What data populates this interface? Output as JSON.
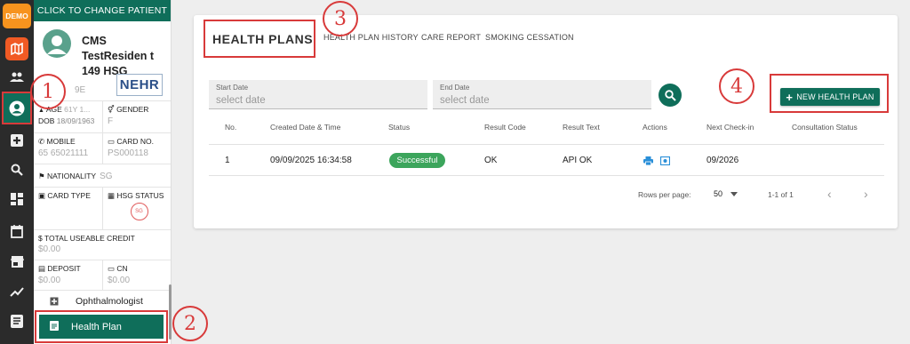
{
  "rail": {
    "demo_label": "DEMO",
    "icons": [
      "map-icon",
      "users-icon",
      "person-icon",
      "plus-icon",
      "search-icon",
      "dashboard-icon",
      "calendar-icon",
      "store-icon",
      "trend-icon",
      "document-icon"
    ]
  },
  "sidebar": {
    "change_patient": "CLICK TO CHANGE PATIENT",
    "patient_name": "CMS TestResiden t 149 HSG",
    "id_partial": "9E",
    "nehr": "NEHR",
    "age_label": "AGE",
    "age_value": "61Y 1...",
    "dob_label": "DOB",
    "dob_value": "18/09/1963",
    "gender_label": "GENDER",
    "gender_value": "F",
    "mobile_label": "MOBILE",
    "mobile_value": "65 65021111",
    "card_label": "CARD NO.",
    "card_value": "PS000118",
    "nationality_label": "NATIONALITY",
    "nationality_value": "SG",
    "card_type_label": "CARD TYPE",
    "hsg_status_label": "HSG STATUS",
    "credit_label": "TOTAL USEABLE CREDIT",
    "credit_value": "$0.00",
    "deposit_label": "DEPOSIT",
    "deposit_value": "$0.00",
    "cn_label": "CN",
    "cn_value": "$0.00",
    "menu_ophthalmologist": "Ophthalmologist",
    "menu_health_plan": "Health Plan"
  },
  "tabs": {
    "health_plans": "HEALTH PLANS",
    "history": "HEALTH PLAN HISTORY",
    "care_report": "CARE REPORT",
    "smoking": "SMOKING CESSATION"
  },
  "filters": {
    "start_label": "Start Date",
    "start_placeholder": "select date",
    "end_label": "End Date",
    "end_placeholder": "select date",
    "new_plan": "NEW HEALTH PLAN"
  },
  "table": {
    "headers": {
      "no": "No.",
      "created": "Created Date & Time",
      "status": "Status",
      "result_code": "Result Code",
      "result_text": "Result Text",
      "actions": "Actions",
      "next_checkin": "Next Check-in",
      "consultation": "Consultation Status"
    },
    "rows": [
      {
        "no": "1",
        "created": "09/09/2025 16:34:58",
        "status": "Successful",
        "result_code": "OK",
        "result_text": "API OK",
        "next_checkin": "09/2026",
        "consultation": ""
      }
    ]
  },
  "pagination": {
    "rows_per_page_label": "Rows per page:",
    "rows_per_page_value": "50",
    "range": "1-1 of 1"
  },
  "annotations": [
    "1",
    "2",
    "3",
    "4"
  ],
  "colors": {
    "primary": "#0f6e5a",
    "annotation": "#d83a3a",
    "success": "#3ca55c",
    "demo_badge": "#f7931e",
    "map_badge": "#f15a24"
  }
}
